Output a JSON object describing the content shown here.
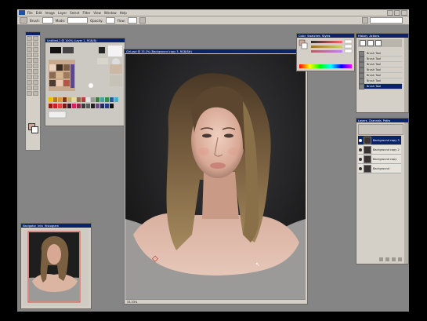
{
  "menu": {
    "items": [
      "File",
      "Edit",
      "Image",
      "Layer",
      "Select",
      "Filter",
      "View",
      "Window",
      "Help"
    ]
  },
  "options_bar": {
    "brush_label": "Brush:",
    "mode_label": "Mode:",
    "opacity_label": "Opacity:",
    "flow_label": "Flow:"
  },
  "reference_window": {
    "title": "Untitled-1 @ 100% (Layer 1, RGB/8)"
  },
  "document_window": {
    "title": "Girl.psd @ 33.3% (Background copy 3, RGB/8#)",
    "zoom": "33.33%"
  },
  "navigator": {
    "tabs": [
      "Navigator",
      "Info",
      "Histogram"
    ]
  },
  "color_panel": {
    "tabs": [
      "Color",
      "Swatches",
      "Styles"
    ]
  },
  "history_panel": {
    "tabs": [
      "History",
      "Actions"
    ],
    "items": [
      "Brush Tool",
      "Brush Tool",
      "Brush Tool",
      "Brush Tool",
      "Brush Tool",
      "Brush Tool",
      "Brush Tool"
    ]
  },
  "layers_panel": {
    "tabs": [
      "Layers",
      "Channels",
      "Paths"
    ],
    "layers": [
      "Background copy 3",
      "Background copy 2",
      "Background copy",
      "Background"
    ]
  },
  "colors": {
    "workspace": "#858585",
    "panel": "#d4d0c8",
    "titlebar": "#0a246a",
    "skin": "#e0b7a3",
    "hair": "#6b5233",
    "dark_bg": "#1e1e1f"
  }
}
